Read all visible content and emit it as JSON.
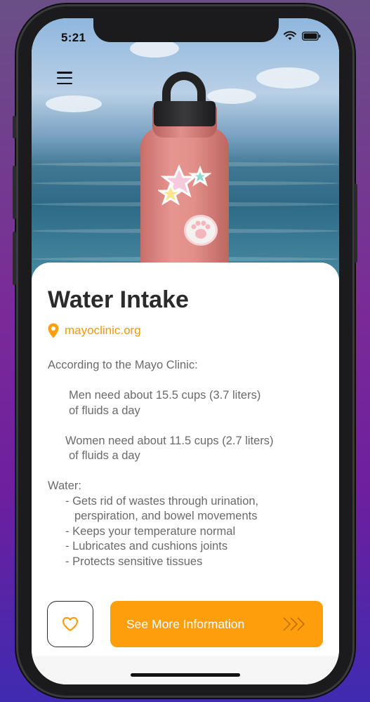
{
  "status_bar": {
    "time": "5:21"
  },
  "article": {
    "title": "Water Intake",
    "source": "mayoclinic.org",
    "intro": "According to the Mayo Clinic:",
    "men_line1": "Men need about 15.5 cups (3.7 liters)",
    "men_line2": "of fluids a day",
    "women_line1": "Women need about 11.5 cups (2.7 liters)",
    "women_line2": "of fluids a day",
    "water_heading": "Water:",
    "benefits": [
      "- Gets rid of wastes through urination,",
      "perspiration, and bowel movements",
      "- Keeps your temperature normal",
      "- Lubricates and cushions joints",
      "- Protects sensitive tissues"
    ]
  },
  "actions": {
    "more_label": "See More Information",
    "more_arrows": "›››"
  },
  "icons": {
    "menu": "hamburger-icon",
    "location": "location-pin-icon",
    "favorite": "heart-icon",
    "wifi": "wifi-icon",
    "battery": "battery-icon"
  },
  "colors": {
    "accent": "#FF9E0D",
    "title": "#2B2B2B",
    "body": "#6A6A6A"
  }
}
